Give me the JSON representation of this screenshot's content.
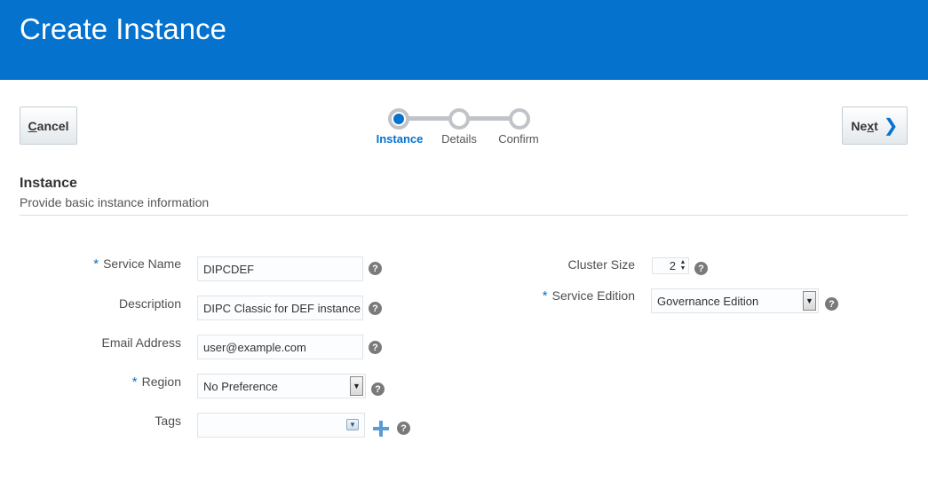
{
  "header": {
    "title": "Create Instance"
  },
  "toolbar": {
    "cancel_access": "C",
    "cancel_rest": "ancel",
    "next_pre": "Ne",
    "next_access": "x",
    "next_post": "t"
  },
  "train": {
    "steps": [
      {
        "label": "Instance",
        "state": "active"
      },
      {
        "label": "Details",
        "state": "pending"
      },
      {
        "label": "Confirm",
        "state": "pending"
      }
    ]
  },
  "section": {
    "title": "Instance",
    "subtitle": "Provide basic instance information"
  },
  "form_left": {
    "service_name": {
      "label": "Service Name",
      "required": "*",
      "value": "DIPCDEF"
    },
    "description": {
      "label": "Description",
      "value": "DIPC Classic for DEF instance"
    },
    "email": {
      "label": "Email Address",
      "value": "user@example.com"
    },
    "region": {
      "label": "Region",
      "required": "*",
      "value": "No Preference"
    },
    "tags": {
      "label": "Tags",
      "value": ""
    }
  },
  "form_right": {
    "cluster_size": {
      "label": "Cluster Size",
      "value": "2"
    },
    "service_edition": {
      "label": "Service Edition",
      "required": "*",
      "value": "Governance Edition"
    }
  },
  "icons": {
    "help": "?",
    "select_arrow": "▼",
    "next_chevron": "❯",
    "spin_up": "▲",
    "spin_down": "▼"
  },
  "colors": {
    "header_bg": "#0572ce",
    "accent": "#0572ce",
    "help_bg": "#7a7a7a",
    "plus": "#5b9bd5"
  }
}
